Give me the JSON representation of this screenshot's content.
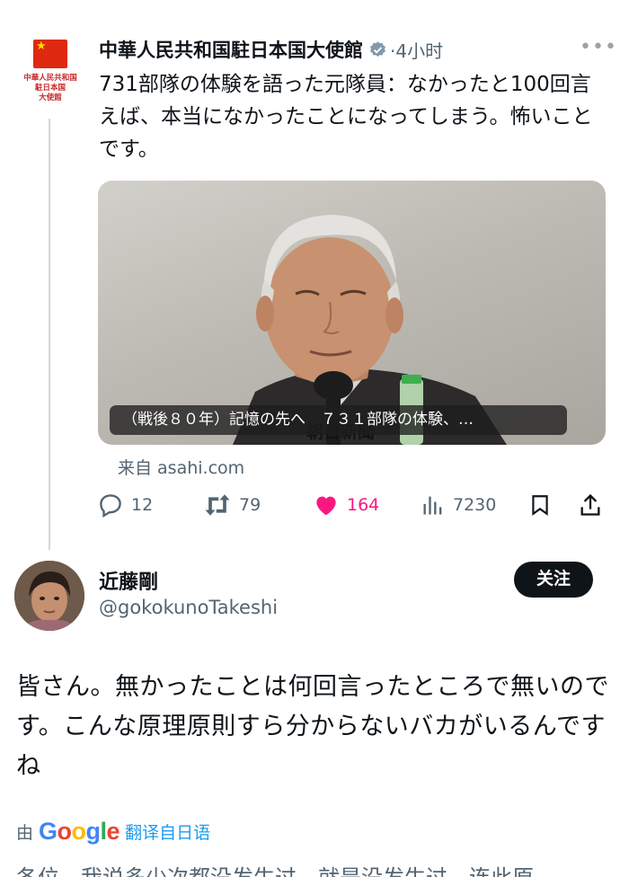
{
  "tweet": {
    "account_logo_text": [
      "中華人民共和国",
      "駐日本国",
      "大使館"
    ],
    "name": "中華人民共和国駐日本国大使館",
    "time": "·4小时",
    "text": "731部隊の体験を語った元隊員：なかったと100回言えば、本当になかったことになってしまう。怖いことです。",
    "media": {
      "caption": "（戦後８０年）記憶の先へ　７３１部隊の体験、…",
      "watermark": "朝日新聞"
    },
    "source": "来自 asahi.com",
    "stats": {
      "replies": "12",
      "retweets": "79",
      "likes": "164",
      "views": "7230"
    },
    "colors": {
      "like": "#f91880",
      "verified": "#829aab"
    }
  },
  "reply": {
    "name": "近藤剛",
    "handle": "@gokokunoTakeshi",
    "follow_label": "关注",
    "text": "皆さん。無かったことは何回言ったところで無いのです。こんな原理原則すら分からないバカがいるんですね",
    "translate": {
      "prefix": "由",
      "brand": "Google",
      "label": "翻译自日语"
    },
    "translated_text_partial": "各位。我说多少次都没发生过，就是没发生过。连此原"
  }
}
